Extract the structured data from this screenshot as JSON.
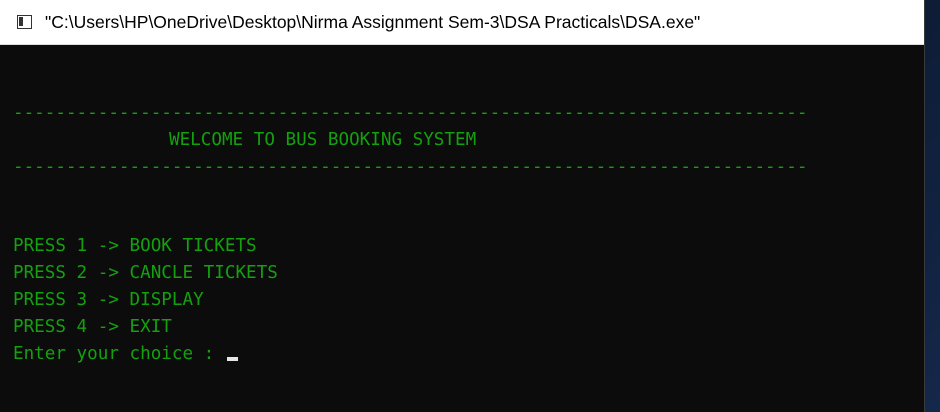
{
  "window": {
    "title": "\"C:\\Users\\HP\\OneDrive\\Desktop\\Nirma Assignment Sem-3\\DSA Practicals\\DSA.exe\""
  },
  "console": {
    "separator_top": "---------------------------------------------------------------------------",
    "welcome": "WELCOME TO BUS BOOKING SYSTEM",
    "separator_bottom": "---------------------------------------------------------------------------",
    "menu": [
      "PRESS 1 -> BOOK TICKETS",
      "PRESS 2 -> CANCLE TICKETS",
      "PRESS 3 -> DISPLAY",
      "PRESS 4 -> EXIT"
    ],
    "prompt": "Enter your choice : "
  },
  "colors": {
    "console_bg": "#0c0c0c",
    "console_text": "#13a10e",
    "titlebar_bg": "#ffffff"
  }
}
